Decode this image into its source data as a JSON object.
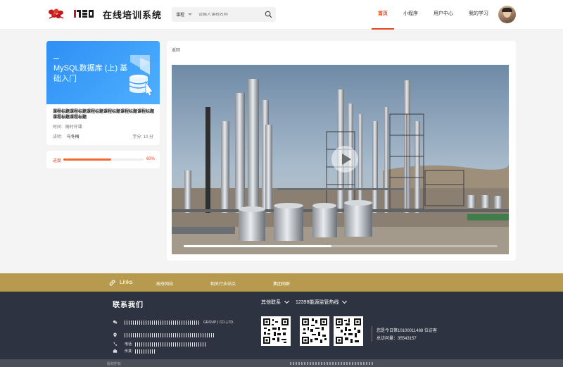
{
  "header": {
    "brand": {
      "part_a": "",
      "part_b": ""
    },
    "site_title": "在线培训系统",
    "search": {
      "category": "课程",
      "placeholder": "请输入课程名称"
    },
    "nav": [
      {
        "label": "首页",
        "active": true
      },
      {
        "label": "小程序",
        "active": false
      },
      {
        "label": "用户中心",
        "active": false
      },
      {
        "label": "我的学习",
        "active": false
      }
    ],
    "accent_color": "#e8461f"
  },
  "course": {
    "cover_title": "MySQL数据库 (上) 基础入门",
    "name": "课程标题课程标题课程标题课程标题课程标题课程标题课程标题课程标题",
    "time_label": "时间:",
    "time_value": "随时开课",
    "teacher_label": "讲师:",
    "teacher_value": "马冬梅",
    "credit": "学分: 10 分"
  },
  "progress": {
    "label": "进度",
    "value": "60%",
    "percent": 60
  },
  "main": {
    "back_label": "返回",
    "video": {
      "playback_percent": 47
    }
  },
  "links": {
    "title": "Links",
    "items": [
      "政府网站",
      "相关行业站点",
      "集团网群"
    ]
  },
  "footer": {
    "contact_title": "联系我们",
    "company_en": "GROUP ) CO.,LTD.",
    "address_label": "",
    "phone_label": "电话:",
    "fax_label": "传真:",
    "other_contact": "其他联系",
    "hotline": "12398能源监管热线",
    "visits_today": "您是今日第10100011488 位访客",
    "visits_total": "总访问量：35543157",
    "copyright": "版权所有"
  }
}
